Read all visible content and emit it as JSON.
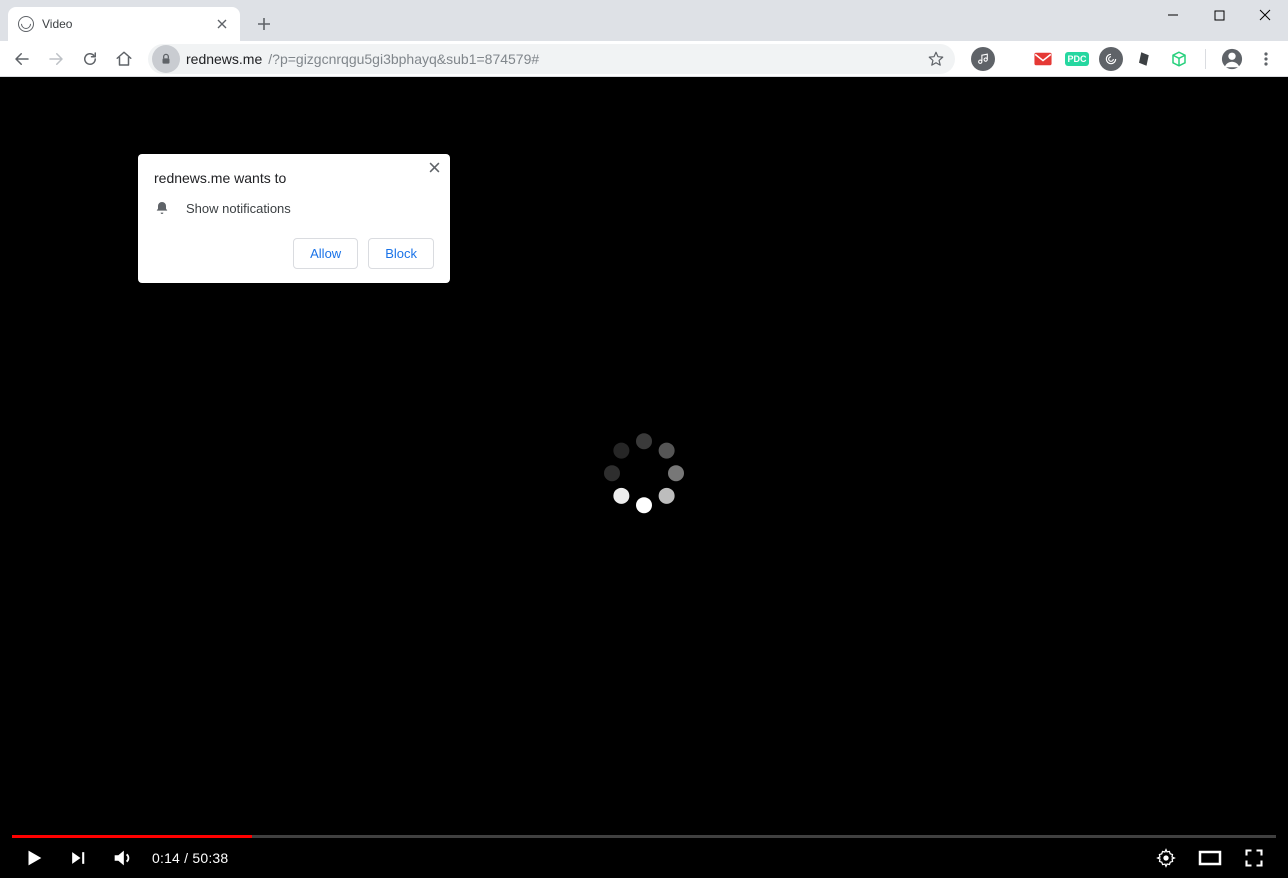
{
  "tab": {
    "title": "Video"
  },
  "url": {
    "domain": "rednews.me",
    "rest": "/?p=gizgcnrqgu5gi3bphayq&sub1=874579#"
  },
  "permission": {
    "title": "rednews.me wants to",
    "item": "Show notifications",
    "allow": "Allow",
    "block": "Block"
  },
  "video": {
    "current": "0:14",
    "sep": " / ",
    "duration": "50:38",
    "progress_pct": 19
  },
  "extensions": {
    "pdc_label": "PDC"
  }
}
